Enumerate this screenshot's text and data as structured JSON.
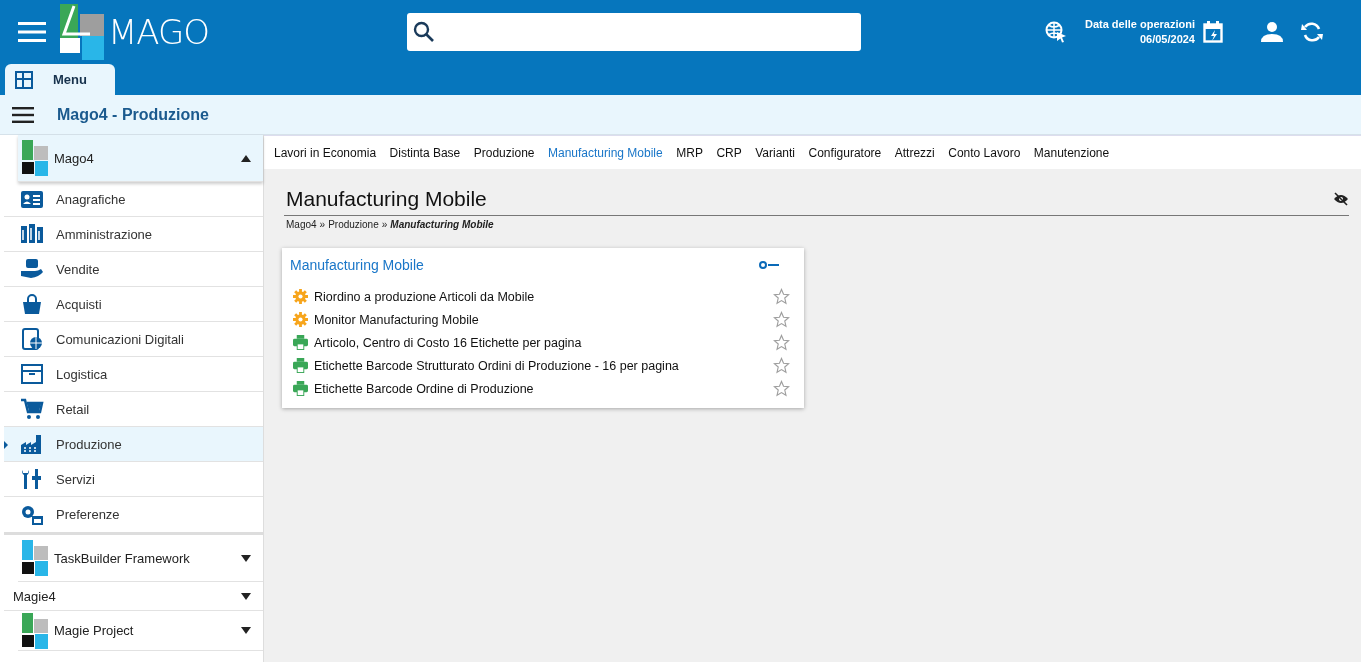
{
  "header": {
    "logo_text": "MAGO",
    "date_label": "Data delle operazioni",
    "date_value": "06/05/2024"
  },
  "tabs": [
    {
      "label": "Menu",
      "selected": true
    }
  ],
  "breadcrumb_bar": {
    "title": "Mago4 - Produzione"
  },
  "sidebar": {
    "groups": [
      {
        "label": "Mago4",
        "kind": "logo",
        "expanded": true,
        "items": [
          {
            "label": "Anagrafiche",
            "selected": false
          },
          {
            "label": "Amministrazione",
            "selected": false
          },
          {
            "label": "Vendite",
            "selected": false
          },
          {
            "label": "Acquisti",
            "selected": false
          },
          {
            "label": "Comunicazioni Digitali",
            "selected": false
          },
          {
            "label": "Logistica",
            "selected": false
          },
          {
            "label": "Retail",
            "selected": false
          },
          {
            "label": "Produzione",
            "selected": true
          },
          {
            "label": "Servizi",
            "selected": false
          },
          {
            "label": "Preferenze",
            "selected": false
          }
        ]
      },
      {
        "label": "TaskBuilder Framework",
        "kind": "logo",
        "expanded": false
      },
      {
        "label": "Magie4",
        "kind": "plain",
        "expanded": false
      },
      {
        "label": "Magie Project",
        "kind": "logo",
        "expanded": false
      }
    ]
  },
  "module_tabs": [
    {
      "label": "Lavori in Economia",
      "selected": false
    },
    {
      "label": "Distinta Base",
      "selected": false
    },
    {
      "label": "Produzione",
      "selected": false
    },
    {
      "label": "Manufacturing Mobile",
      "selected": true
    },
    {
      "label": "MRP",
      "selected": false
    },
    {
      "label": "CRP",
      "selected": false
    },
    {
      "label": "Varianti",
      "selected": false
    },
    {
      "label": "Configuratore",
      "selected": false
    },
    {
      "label": "Attrezzi",
      "selected": false
    },
    {
      "label": "Conto Lavoro",
      "selected": false
    },
    {
      "label": "Manutenzione",
      "selected": false
    }
  ],
  "page": {
    "title": "Manufacturing Mobile",
    "path": [
      "Mago4",
      "Produzione"
    ],
    "separator": "»",
    "path_current": "Manufacturing Mobile",
    "card": {
      "title": "Manufacturing Mobile",
      "items": [
        {
          "label": "Riordino a produzione Articoli da Mobile",
          "kind": "procedure",
          "starred": false
        },
        {
          "label": "Monitor Manufacturing Mobile",
          "kind": "procedure",
          "starred": false
        },
        {
          "label": "Articolo, Centro di Costo 16 Etichette per pagina",
          "kind": "report",
          "starred": false
        },
        {
          "label": "Etichette Barcode Strutturato Ordini di Produzione - 16 per pagina",
          "kind": "report",
          "starred": false
        },
        {
          "label": "Etichette Barcode Ordine di Produzione",
          "kind": "report",
          "starred": false
        }
      ]
    }
  }
}
